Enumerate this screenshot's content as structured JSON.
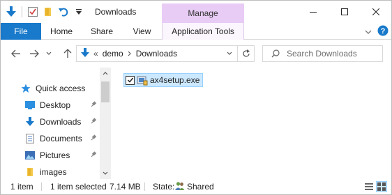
{
  "window": {
    "title": "Downloads",
    "contextual_tab": "Manage",
    "accent_color": "#1979ca",
    "manage_color": "#e8ccf5"
  },
  "quick_access_toolbar": {
    "icons": [
      "downloads-arrow-icon",
      "properties-check-icon",
      "new-folder-icon",
      "undo-icon",
      "customize-dropdown-icon"
    ]
  },
  "window_controls": [
    "minimize-icon",
    "maximize-icon",
    "close-icon"
  ],
  "ribbon": {
    "tabs": [
      "File",
      "Home",
      "Share",
      "View",
      "Application Tools"
    ],
    "right_icons": [
      "expand-ribbon-icon",
      "help-icon"
    ]
  },
  "address_bar": {
    "overflow": "«",
    "crumbs": [
      "demo",
      "Downloads"
    ],
    "search_placeholder": "Search Downloads"
  },
  "nav_pane": {
    "items": [
      {
        "label": "Quick access",
        "icon": "star-icon",
        "pinned": false
      },
      {
        "label": "Desktop",
        "icon": "desktop-icon",
        "pinned": true
      },
      {
        "label": "Downloads",
        "icon": "download-icon",
        "pinned": true
      },
      {
        "label": "Documents",
        "icon": "documents-icon",
        "pinned": true
      },
      {
        "label": "Pictures",
        "icon": "pictures-icon",
        "pinned": true
      },
      {
        "label": "images",
        "icon": "folder-icon",
        "pinned": false
      }
    ]
  },
  "files": [
    {
      "name": "ax4setup.exe",
      "selected": true,
      "checked": true
    }
  ],
  "status_bar": {
    "item_count": "1 item",
    "selected": "1 item selected",
    "size": "7.14 MB",
    "state_label": "State:",
    "state_value": "Shared"
  }
}
